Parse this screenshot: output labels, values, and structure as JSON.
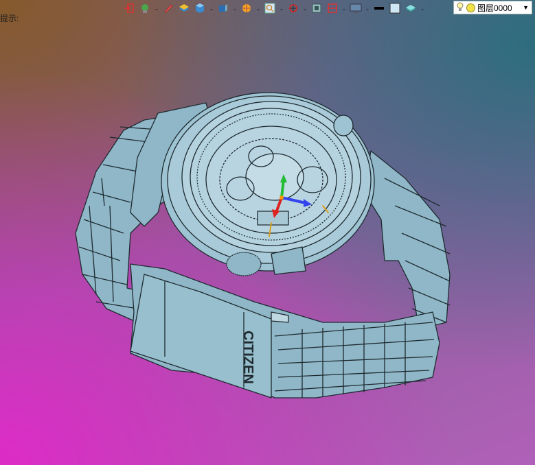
{
  "status": {
    "prompt_text": "提示:"
  },
  "toolbar": {
    "tools": [
      {
        "icon": "exit-icon",
        "color": "#d33"
      },
      {
        "icon": "component-icon",
        "color": "#2a8a2a"
      },
      {
        "icon": "pen-icon",
        "color": "#c33"
      },
      {
        "icon": "layers-icon",
        "color": "#d9a020"
      },
      {
        "icon": "cube-icon",
        "color": "#2277cc"
      },
      {
        "icon": "view-cube-icon",
        "color": "#2277cc"
      },
      {
        "icon": "render-icon",
        "color": "#f09010"
      },
      {
        "icon": "zoom-icon",
        "color": "#3366cc"
      },
      {
        "icon": "rotate-icon",
        "color": "#cc2222"
      },
      {
        "icon": "snapshot-icon",
        "color": "#333"
      },
      {
        "icon": "section-icon",
        "color": "#d33"
      },
      {
        "icon": "display-icon",
        "color": "#555"
      },
      {
        "icon": "line-color-icon",
        "color": "#000"
      },
      {
        "icon": "fill-color-icon",
        "color": "#cfe6f5"
      },
      {
        "icon": "material-icon",
        "color": "#3aa"
      }
    ],
    "layer_select": {
      "value": "图层0000"
    }
  },
  "model": {
    "brand_text": "CITIZEN",
    "body_color": "#8fb7c7",
    "edge_color": "#1e2a30"
  },
  "triad": {
    "x_color": "#3344ee",
    "y_color": "#22bb33",
    "z_color": "#dd2222"
  }
}
